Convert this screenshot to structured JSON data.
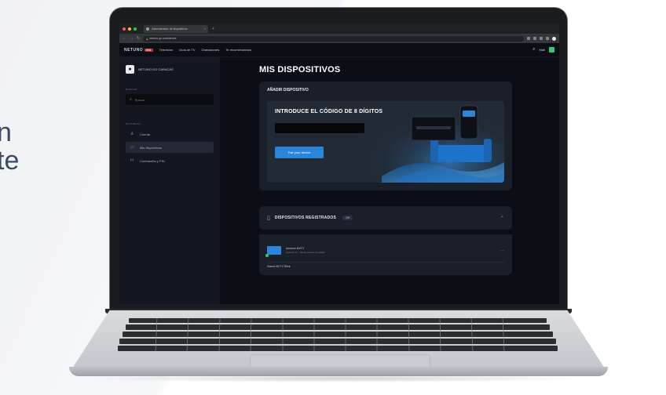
{
  "left_text": {
    "line1": "n",
    "line2": "te"
  },
  "browser": {
    "tab_title": "Administrador de dispositivos",
    "tab_close": "×",
    "new_tab": "+",
    "url": "netuno.go.com/device"
  },
  "header": {
    "logo": "NETUNO",
    "logo_badge": "GO",
    "nav": [
      "Televisión",
      "Guía de TV",
      "Grabaciones",
      "Te recomendamos"
    ],
    "user": "Mati"
  },
  "sidebar": {
    "profile_name": "NETUNO GO CARACAS",
    "search_section": "BUSCAR",
    "search_placeholder": "Buscar",
    "menu_section": "MI CUENTA",
    "items": [
      {
        "label": "Cuenta",
        "icon": "user-icon"
      },
      {
        "label": "Mis dispositivos",
        "icon": "device-icon"
      },
      {
        "label": "Contraseña y PIN",
        "icon": "lock-icon"
      }
    ]
  },
  "main": {
    "page_title": "MIS DISPOSITIVOS",
    "add_card_title": "AÑADIR DISPOSITIVO",
    "code_title": "INTRODUCE EL CÓDIGO DE 8 DÍGITOS",
    "pair_button": "Pair your device",
    "registered_title": "DISPOSITIVOS REGISTRADOS",
    "registered_count": "1/5",
    "devices": [
      {
        "name": "Amazon fireTV",
        "sub": "Android TV · Último acceso 1-1-2022"
      }
    ],
    "next_device": "Xiaomi MI TV Stick",
    "more": "···"
  },
  "colors": {
    "accent": "#2b86d9",
    "brand_red": "#c7313b",
    "status_green": "#2ecc71"
  }
}
